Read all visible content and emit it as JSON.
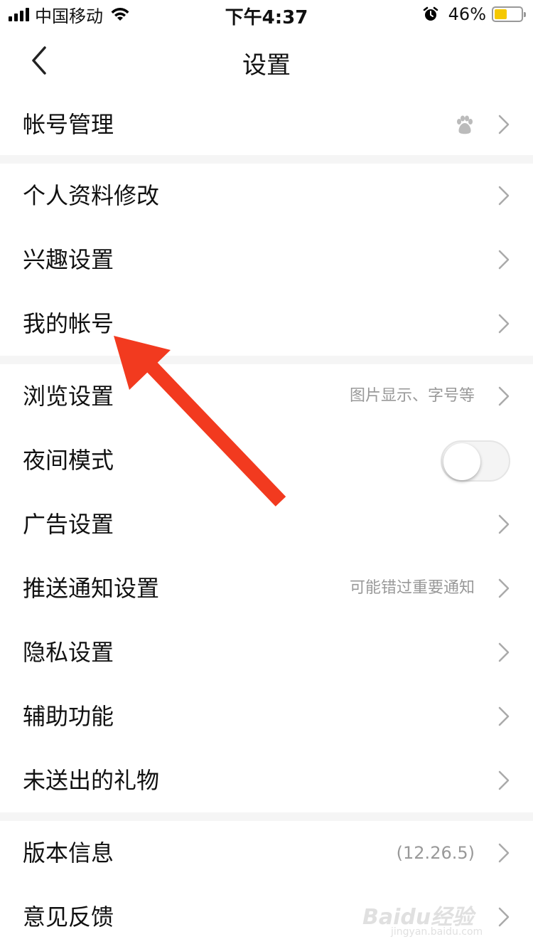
{
  "status_bar": {
    "carrier": "中国移动",
    "time": "下午4:37",
    "battery_percent": "46%",
    "battery_level": 0.46,
    "battery_color": "#f5c800"
  },
  "nav": {
    "title": "设置",
    "back_icon": "chevron-left-icon"
  },
  "groups": [
    {
      "items": [
        {
          "label": "帐号管理",
          "trailing_icon": "baidu-paw-icon"
        }
      ]
    },
    {
      "items": [
        {
          "label": "个人资料修改"
        },
        {
          "label": "兴趣设置"
        },
        {
          "label": "我的帐号"
        }
      ]
    },
    {
      "items": [
        {
          "label": "浏览设置",
          "hint": "图片显示、字号等"
        },
        {
          "label": "夜间模式",
          "toggle": false
        },
        {
          "label": "广告设置"
        },
        {
          "label": "推送通知设置",
          "hint": "可能错过重要通知"
        },
        {
          "label": "隐私设置"
        },
        {
          "label": "辅助功能"
        },
        {
          "label": "未送出的礼物"
        }
      ]
    },
    {
      "items": [
        {
          "label": "版本信息",
          "hint": "(12.26.5)"
        },
        {
          "label": "意见反馈"
        }
      ]
    }
  ],
  "annotation": {
    "color": "#f23a1f",
    "icon": "arrow-annotation"
  },
  "watermark": {
    "text": "Baidu经验",
    "sub": "jingyan.baidu.com"
  }
}
